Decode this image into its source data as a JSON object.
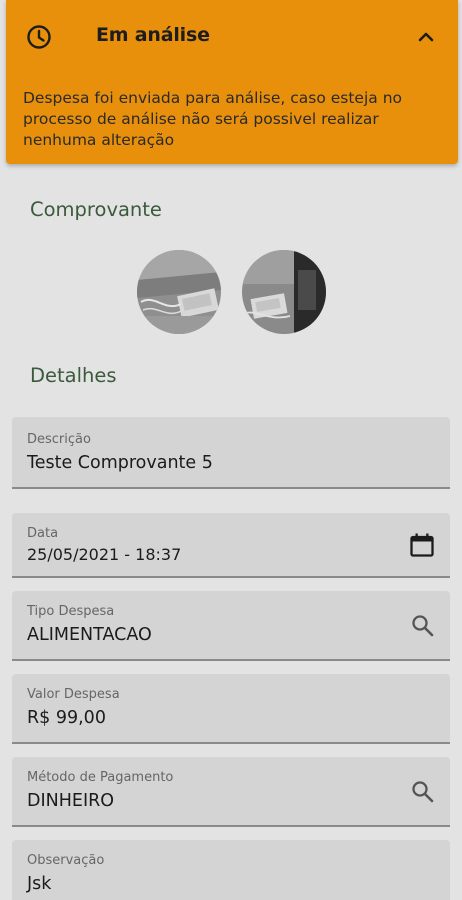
{
  "status_banner": {
    "title": "Em análise",
    "message": "Despesa foi enviada para análise, caso esteja no processo de análise não será possivel realizar nenhuma alteração",
    "color": "#e8900b",
    "icon": "clock-icon",
    "toggle_icon": "chevron-up-icon"
  },
  "receipt": {
    "title": "Comprovante",
    "images": [
      {
        "name": "receipt-photo-1"
      },
      {
        "name": "receipt-photo-2"
      }
    ]
  },
  "details": {
    "title": "Detalhes",
    "fields": {
      "description": {
        "label": "Descrição",
        "value": "Teste Comprovante 5"
      },
      "date": {
        "label": "Data",
        "value": "25/05/2021 - 18:37",
        "icon": "calendar-icon"
      },
      "expense_type": {
        "label": "Tipo Despesa",
        "value": "ALIMENTACAO",
        "icon": "search-icon"
      },
      "expense_value": {
        "label": "Valor Despesa",
        "value": "R$ 99,00"
      },
      "payment_method": {
        "label": "Método de Pagamento",
        "value": "DINHEIRO",
        "icon": "search-icon"
      },
      "observation": {
        "label": "Observação",
        "value": "Jsk"
      }
    }
  }
}
